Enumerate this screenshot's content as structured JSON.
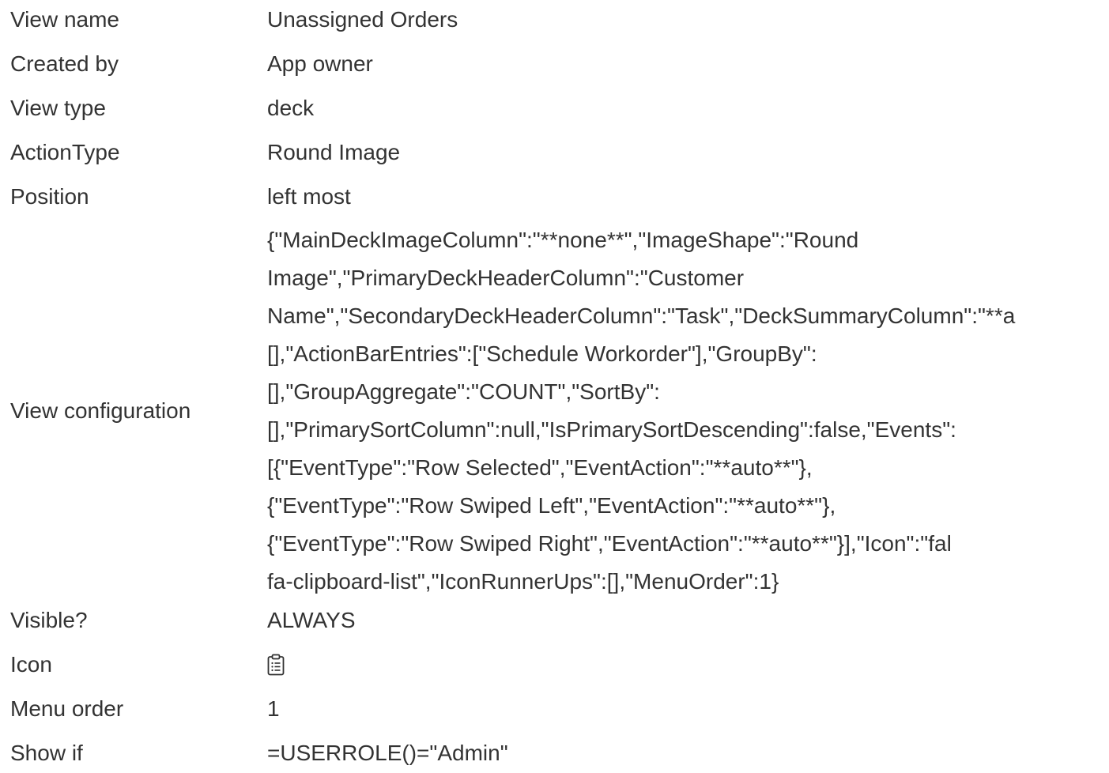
{
  "rows": {
    "view_name": {
      "label": "View name",
      "value": "Unassigned Orders"
    },
    "created_by": {
      "label": "Created by",
      "value": "App owner"
    },
    "view_type": {
      "label": "View type",
      "value": "deck"
    },
    "action_type": {
      "label": "ActionType",
      "value": "Round Image"
    },
    "position": {
      "label": "Position",
      "value": "left most"
    },
    "view_configuration": {
      "label": "View configuration",
      "lines": [
        "{\"MainDeckImageColumn\":\"**none**\",\"ImageShape\":\"Round",
        "Image\",\"PrimaryDeckHeaderColumn\":\"Customer",
        "Name\",\"SecondaryDeckHeaderColumn\":\"Task\",\"DeckSummaryColumn\":\"**a",
        "[],\"ActionBarEntries\":[\"Schedule Workorder\"],\"GroupBy\":",
        "[],\"GroupAggregate\":\"COUNT\",\"SortBy\":",
        "[],\"PrimarySortColumn\":null,\"IsPrimarySortDescending\":false,\"Events\":",
        "[{\"EventType\":\"Row Selected\",\"EventAction\":\"**auto**\"},",
        "{\"EventType\":\"Row Swiped Left\",\"EventAction\":\"**auto**\"},",
        "{\"EventType\":\"Row Swiped Right\",\"EventAction\":\"**auto**\"}],\"Icon\":\"fal",
        "fa-clipboard-list\",\"IconRunnerUps\":[],\"MenuOrder\":1}"
      ]
    },
    "visible": {
      "label": "Visible?",
      "value": "ALWAYS"
    },
    "icon": {
      "label": "Icon",
      "icon_name": "clipboard-list-icon"
    },
    "menu_order": {
      "label": "Menu order",
      "value": "1"
    },
    "show_if": {
      "label": "Show if",
      "value": "=USERROLE()=\"Admin\""
    }
  }
}
